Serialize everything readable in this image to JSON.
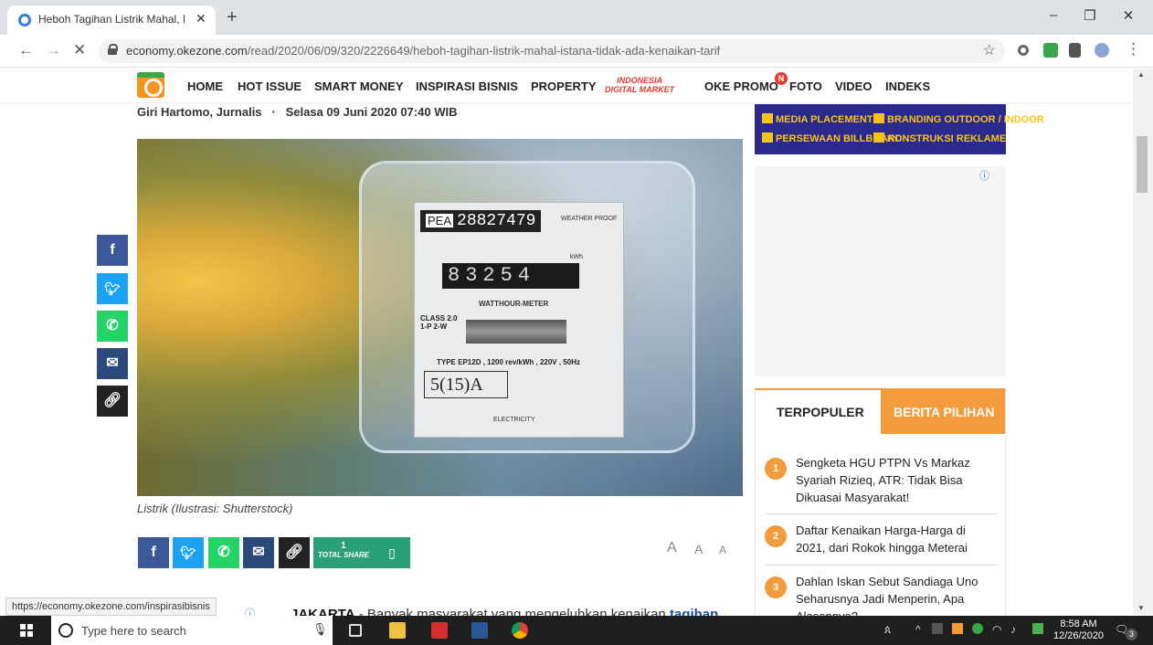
{
  "browser": {
    "tab_title": "Heboh Tagihan Listrik Mahal, Ista",
    "tab_close": "✕",
    "new_tab": "+",
    "url_host": "economy.okezone.com",
    "url_path": "/read/2020/06/09/320/2226649/heboh-tagihan-listrik-mahal-istana-tidak-ada-kenaikan-tarif",
    "status_url": "https://economy.okezone.com/inspirasibisnis",
    "window_minimize": "–",
    "window_restore": "❐",
    "window_close": "✕"
  },
  "site_nav": {
    "items": [
      "HOME",
      "HOT ISSUE",
      "SMART MONEY",
      "INSPIRASI BISNIS",
      "PROPERTY",
      "OKE PROMO",
      "FOTO",
      "VIDEO",
      "INDEKS"
    ],
    "idm_line1": "INDONESIA",
    "idm_line2": "DIGITAL MARKET",
    "promo_badge": "N"
  },
  "article": {
    "byline_author": "Giri Hartomo, Jurnalis",
    "byline_sep": "·",
    "byline_date": "Selasa 09 Juni 2020 07:40 WIB",
    "caption": "Listrik (Ilustrasi: Shutterstock)",
    "body_lead": "JAKARTA",
    "body_text": " - Banyak masyarakat yang mengeluhkan kenaikan ",
    "body_link": "tagihan",
    "photo": {
      "meter_pea": "PEA",
      "meter_serial": "28827479",
      "meter_weatherproof": "WEATHER PROOF",
      "meter_kwh": "kWh",
      "meter_counter": "83254",
      "meter_watthour": "WATTHOUR-METER",
      "meter_class_1": "CLASS 2.0",
      "meter_class_2": "1-P 2-W",
      "meter_type": "TYPE EP12D ,  1200 rev/kWh , 220V , 50Hz",
      "meter_rating": "5(15)A",
      "meter_electricity": "ELECTRICITY"
    }
  },
  "share": {
    "total_count": "1",
    "total_label": "TOTAL SHARE",
    "font_sizes": [
      "A",
      "A",
      "A"
    ]
  },
  "banner": {
    "items": [
      "MEDIA PLACEMENT",
      "BRANDING OUTDOOR / INDOOR",
      "PERSEWAAN BILLBOARD",
      "KONSTRUKSI REKLAME"
    ]
  },
  "widget": {
    "tab_terpopuler": "TERPOPULER",
    "tab_pilihan": "BERITA PILIHAN",
    "items": [
      {
        "num": "1",
        "text": "Sengketa HGU PTPN Vs Markaz Syariah Rizieq, ATR: Tidak Bisa Dikuasai Masyarakat!"
      },
      {
        "num": "2",
        "text": "Daftar Kenaikan Harga-Harga di 2021, dari Rokok hingga Meterai"
      },
      {
        "num": "3",
        "text": "Dahlan Iskan Sebut Sandiaga Uno Seharusnya Jadi Menperin, Apa Alasannya?"
      }
    ]
  },
  "taskbar": {
    "search_placeholder": "Type here to search",
    "time": "8:58 AM",
    "date": "12/26/2020",
    "notification_count": "3"
  },
  "colors": {
    "accent_orange": "#f39c3d",
    "share_green": "#2aa079",
    "facebook": "#3b5998",
    "twitter": "#1da1f2",
    "whatsapp": "#25d366",
    "email": "#2b4a7a",
    "link": "#222222"
  }
}
